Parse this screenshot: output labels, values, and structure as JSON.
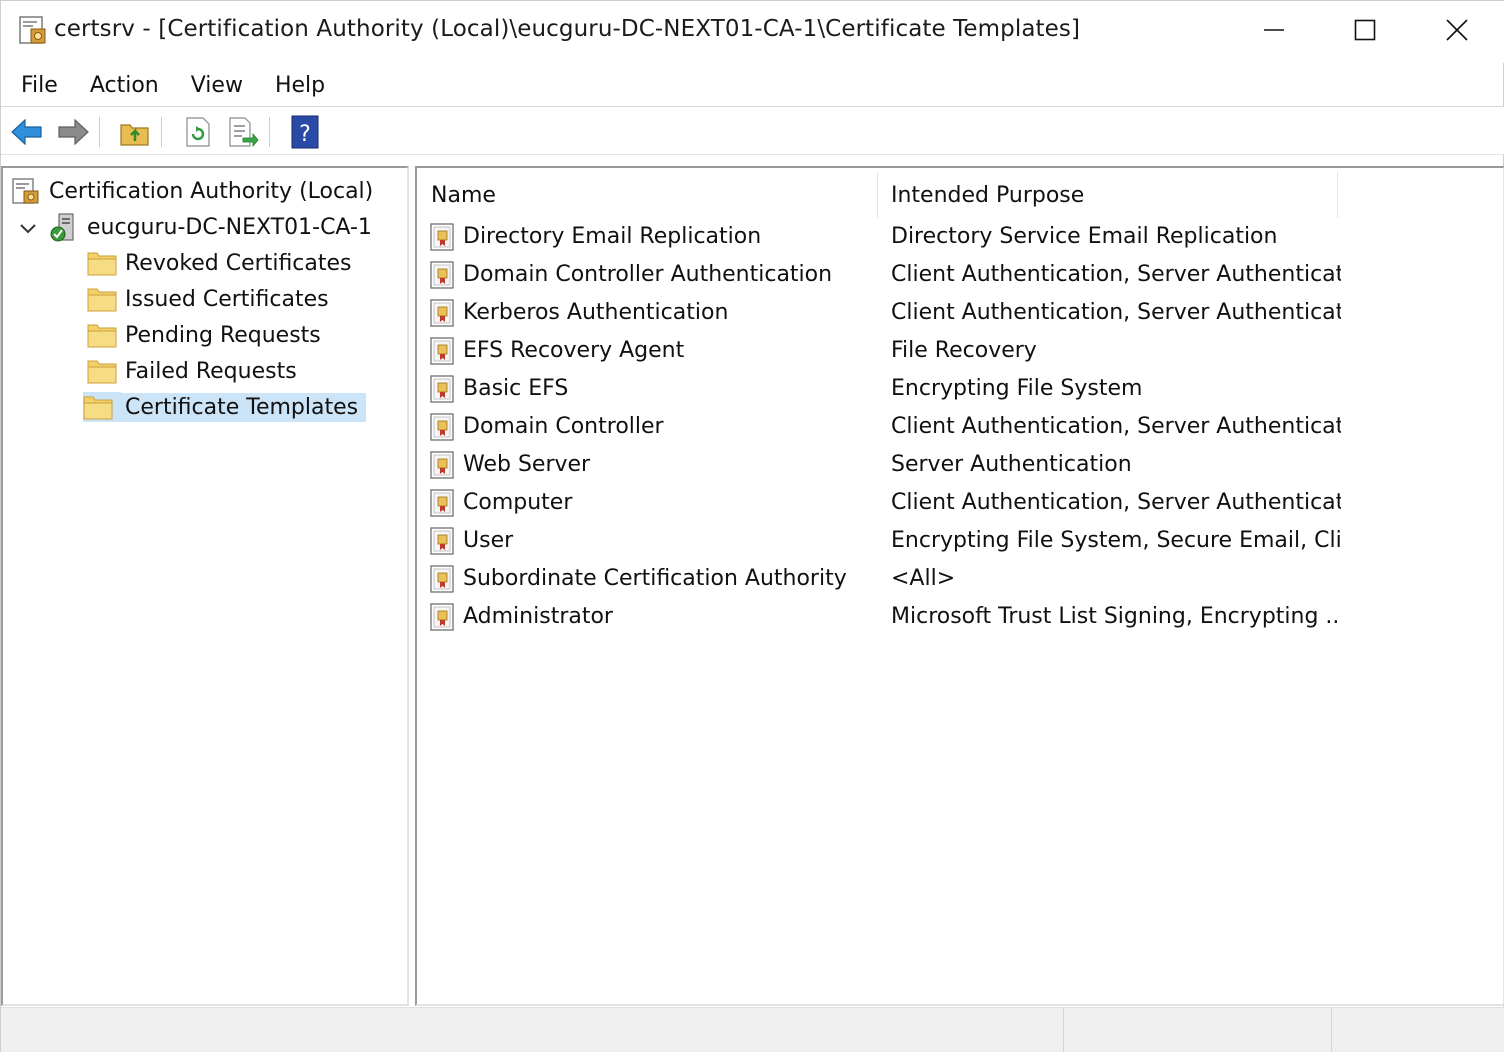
{
  "window": {
    "title": "certsrv - [Certification Authority (Local)\\eucguru-DC-NEXT01-CA-1\\Certificate Templates]",
    "icon": "certsrv-app-icon",
    "controls": [
      "minimize-icon",
      "maximize-icon",
      "close-icon"
    ]
  },
  "menu": {
    "items": [
      {
        "label": "File"
      },
      {
        "label": "Action"
      },
      {
        "label": "View"
      },
      {
        "label": "Help"
      }
    ]
  },
  "toolbar": {
    "buttons": [
      {
        "icon": "back-arrow-icon"
      },
      {
        "icon": "forward-arrow-icon"
      },
      {
        "icon": "up-folder-icon"
      },
      {
        "icon": "refresh-icon"
      },
      {
        "icon": "export-list-icon"
      },
      {
        "icon": "help-icon"
      }
    ]
  },
  "tree": {
    "root": {
      "label": "Certification Authority (Local)",
      "icon": "ca-root-icon"
    },
    "ca": {
      "label": "eucguru-DC-NEXT01-CA-1",
      "icon": "ca-server-icon",
      "expanded": true
    },
    "children": [
      {
        "label": "Revoked Certificates",
        "icon": "folder-icon"
      },
      {
        "label": "Issued Certificates",
        "icon": "folder-icon"
      },
      {
        "label": "Pending Requests",
        "icon": "folder-icon"
      },
      {
        "label": "Failed Requests",
        "icon": "folder-icon"
      },
      {
        "label": "Certificate Templates",
        "icon": "folder-icon",
        "selected": true
      }
    ]
  },
  "list": {
    "columns": [
      {
        "label": "Name"
      },
      {
        "label": "Intended Purpose"
      }
    ],
    "rows": [
      {
        "name": "Directory Email Replication",
        "purpose": "Directory Service Email Replication"
      },
      {
        "name": "Domain Controller Authentication",
        "purpose": "Client Authentication, Server Authenticat..."
      },
      {
        "name": "Kerberos Authentication",
        "purpose": "Client Authentication, Server Authenticat..."
      },
      {
        "name": "EFS Recovery Agent",
        "purpose": "File Recovery"
      },
      {
        "name": "Basic EFS",
        "purpose": "Encrypting File System"
      },
      {
        "name": "Domain Controller",
        "purpose": "Client Authentication, Server Authenticat..."
      },
      {
        "name": "Web Server",
        "purpose": "Server Authentication"
      },
      {
        "name": "Computer",
        "purpose": "Client Authentication, Server Authenticat..."
      },
      {
        "name": "User",
        "purpose": "Encrypting File System, Secure Email, Cli..."
      },
      {
        "name": "Subordinate Certification Authority",
        "purpose": "<All>"
      },
      {
        "name": "Administrator",
        "purpose": "Microsoft Trust List Signing, Encrypting ..."
      }
    ]
  },
  "colors": {
    "selection": "#cce4f7",
    "folder": "#f3d06a",
    "help_blue": "#2a4aa8",
    "arrow_blue": "#2f8fdd"
  }
}
